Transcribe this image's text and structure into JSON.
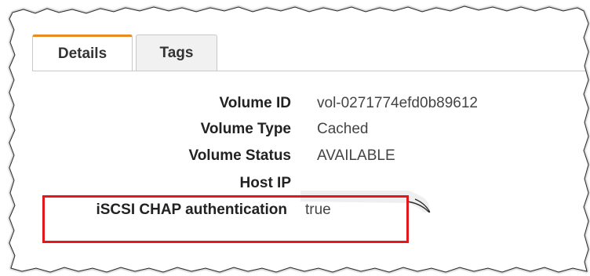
{
  "tabs": [
    {
      "label": "Details",
      "active": true
    },
    {
      "label": "Tags",
      "active": false
    }
  ],
  "details": {
    "volume_id": {
      "label": "Volume ID",
      "value": "vol-0271774efd0b89612"
    },
    "volume_type": {
      "label": "Volume Type",
      "value": "Cached"
    },
    "volume_status": {
      "label": "Volume Status",
      "value": "AVAILABLE"
    },
    "host_ip": {
      "label": "Host IP",
      "value": ""
    },
    "iscsi_chap": {
      "label": "iSCSI CHAP authentication",
      "value": "true"
    }
  },
  "colors": {
    "active_tab_accent": "#e98a22",
    "highlight": "#e3171c"
  }
}
